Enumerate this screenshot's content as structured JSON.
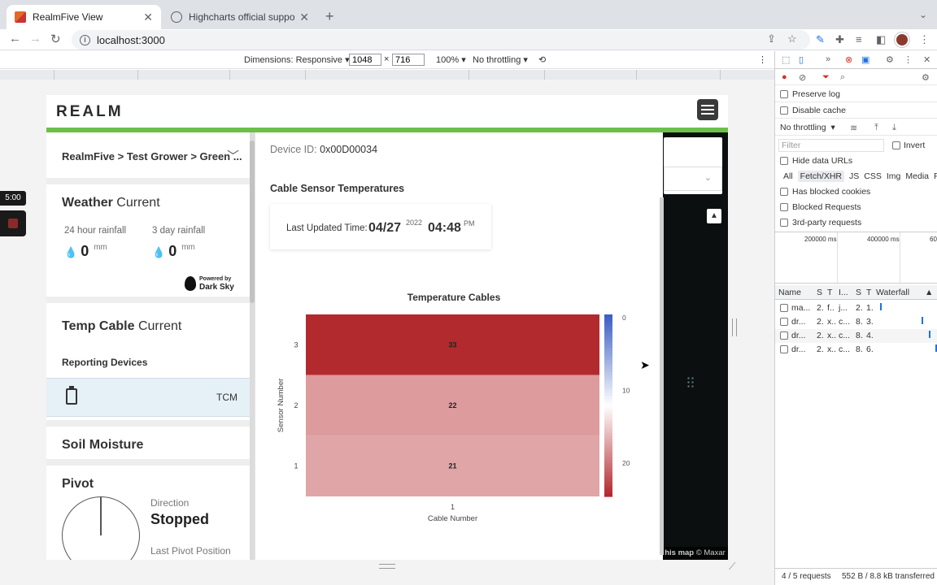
{
  "browser": {
    "tabs": [
      {
        "title": "RealmFive View",
        "active": true
      },
      {
        "title": "Highcharts official support for...",
        "active": false
      }
    ],
    "url": "localhost:3000"
  },
  "device_toolbar": {
    "dimensions_label": "Dimensions: Responsive",
    "width": "1048",
    "times": "×",
    "height": "716",
    "zoom": "100%",
    "throttling": "No throttling"
  },
  "recording": {
    "time": "5:00"
  },
  "app": {
    "logo": "REALM",
    "breadcrumb": "RealmFive > Test Grower > Green ...",
    "weather": {
      "title": "Weather",
      "subtitle": "Current",
      "rain_24h_label": "24 hour rainfall",
      "rain_24h_value": "0",
      "rain_3d_label": "3 day rainfall",
      "rain_3d_value": "0",
      "unit": "mm",
      "powered_by_line1": "Powered by",
      "powered_by_line2": "Dark Sky"
    },
    "temp_cable": {
      "title": "Temp Cable",
      "subtitle": "Current",
      "reporting_label": "Reporting Devices",
      "device_name": "TCM"
    },
    "soil": {
      "title": "Soil Moisture"
    },
    "pivot": {
      "title": "Pivot",
      "direction_label": "Direction",
      "direction_value": "Stopped",
      "last_position_label": "Last Pivot Position"
    },
    "main": {
      "device_id_label": "Device ID:",
      "device_id_value": "0x00D00034",
      "section_title": "Cable Sensor Temperatures",
      "last_updated_label": "Last Updated Time:",
      "last_updated_date": "04/27",
      "last_updated_year": "2022",
      "last_updated_time": "04:48",
      "last_updated_ampm": "PM"
    },
    "map_attribution_bold": "his map",
    "map_attribution_rest": "© Maxar"
  },
  "chart_data": {
    "type": "heatmap",
    "title": "Temperature Cables",
    "xlabel": "Cable Number",
    "ylabel": "Sensor Number",
    "x_categories": [
      "1"
    ],
    "y_categories": [
      "1",
      "2",
      "3"
    ],
    "cells": [
      {
        "x": "1",
        "y": "3",
        "value": 33
      },
      {
        "x": "1",
        "y": "2",
        "value": 22
      },
      {
        "x": "1",
        "y": "1",
        "value": 21
      }
    ],
    "colorbar": {
      "ticks": [
        "0",
        "10",
        "20"
      ],
      "min": 0,
      "max": 25,
      "low_color": "#3d5fc4",
      "high_color": "#b22a2e"
    }
  },
  "devtools": {
    "preserve_log": "Preserve log",
    "disable_cache": "Disable cache",
    "throttling": "No throttling",
    "filter_placeholder": "Filter",
    "invert": "Invert",
    "hide_data_urls": "Hide data URLs",
    "types": [
      "All",
      "Fetch/XHR",
      "JS",
      "CSS",
      "Img",
      "Media",
      "Fo"
    ],
    "has_blocked_cookies": "Has blocked cookies",
    "blocked_requests": "Blocked Requests",
    "third_party": "3rd-party requests",
    "overview_ticks": [
      "200000 ms",
      "400000 ms",
      "60"
    ],
    "columns": [
      "Name",
      "S",
      "T",
      "I...",
      "S",
      "T",
      "Waterfall"
    ],
    "rows": [
      {
        "name": "ma...",
        "c1": "2.",
        "c2": "f..",
        "c3": "j...",
        "c4": "2.",
        "c5": "1."
      },
      {
        "name": "dr...",
        "c1": "2.",
        "c2": "x..",
        "c3": "c...",
        "c4": "8.",
        "c5": "3."
      },
      {
        "name": "dr...",
        "c1": "2.",
        "c2": "x..",
        "c3": "c...",
        "c4": "8.",
        "c5": "4."
      },
      {
        "name": "dr...",
        "c1": "2.",
        "c2": "x..",
        "c3": "c...",
        "c4": "8.",
        "c5": "6."
      }
    ],
    "status_requests": "4 / 5 requests",
    "status_transferred": "552 B / 8.8 kB transferred"
  }
}
